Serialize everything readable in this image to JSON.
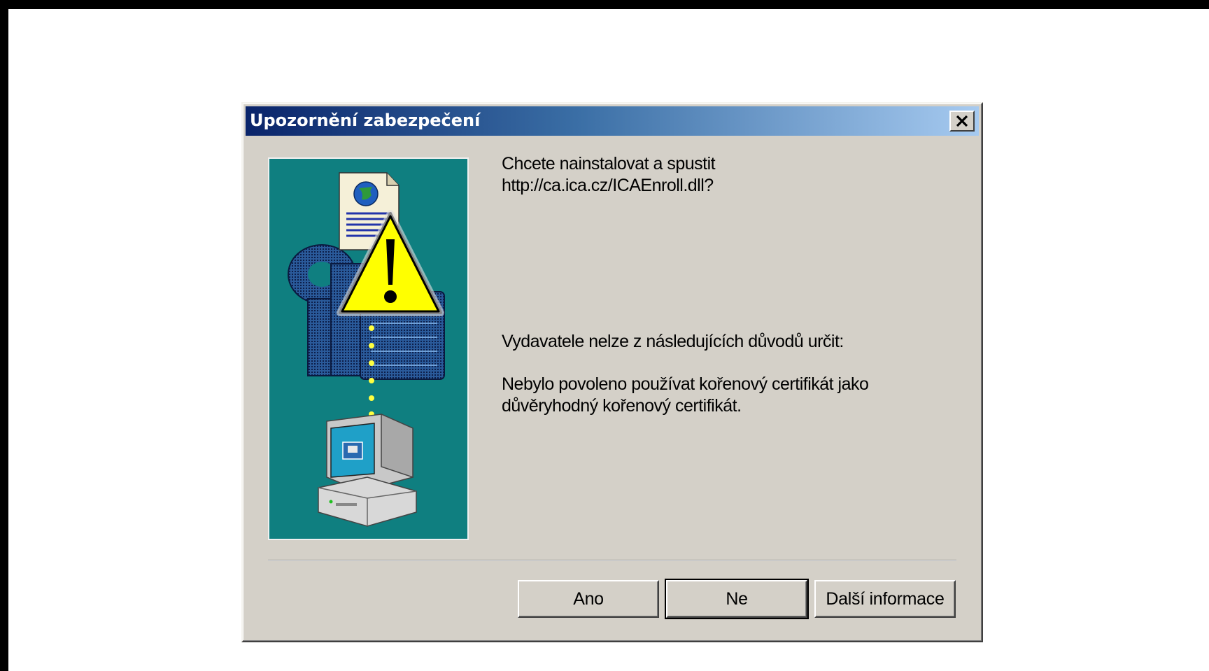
{
  "dialog": {
    "title": "Upozornění zabezpečení",
    "close_icon": "close-icon",
    "illustration_icons": [
      "document-globe-icon",
      "warning-triangle-icon",
      "keys-certificate-icon",
      "computer-icon"
    ],
    "message_line1": "Chcete nainstalovat a spustit",
    "message_line2": "http://ca.ica.cz/ICAEnroll.dll?",
    "reason_heading": "Vydavatele nelze z následujících důvodů určit:",
    "reason_line1": "Nebylo povoleno používat kořenový certifikát jako",
    "reason_line2": "důvěryhodný kořenový certifikát.",
    "buttons": {
      "yes": "Ano",
      "no": "Ne",
      "more_info": "Další informace"
    },
    "colors": {
      "title_gradient_start": "#0a246a",
      "title_gradient_end": "#a6caf0",
      "dialog_face": "#d4d0c8",
      "illustration_bg": "#0f7f80"
    }
  }
}
